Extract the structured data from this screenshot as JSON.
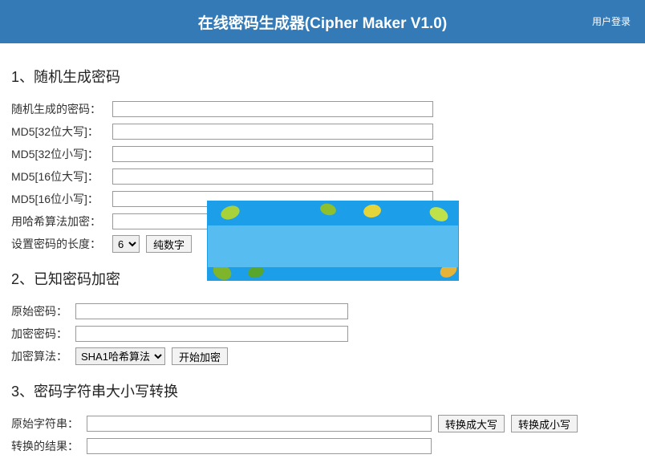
{
  "header": {
    "title": "在线密码生成器(Cipher Maker V1.0)",
    "login": "用户登录"
  },
  "section1": {
    "title": "1、随机生成密码",
    "rows": {
      "generated": "随机生成的密码：",
      "md5_32_upper": "MD5[32位大写]：",
      "md5_32_lower": "MD5[32位小写]：",
      "md5_16_upper": "MD5[16位大写]：",
      "md5_16_lower": "MD5[16位小写]：",
      "hash_encrypt": "用哈希算法加密：",
      "set_length": "设置密码的长度："
    },
    "length_value": "6",
    "type_button": "纯数字"
  },
  "section2": {
    "title": "2、已知密码加密",
    "rows": {
      "original": "原始密码：",
      "encrypted": "加密密码：",
      "algorithm": "加密算法："
    },
    "algorithm_value": "SHA1哈希算法",
    "encrypt_button": "开始加密"
  },
  "section3": {
    "title": "3、密码字符串大小写转换",
    "rows": {
      "original_str": "原始字符串：",
      "result": "转换的结果："
    },
    "to_upper": "转换成大写",
    "to_lower": "转换成小写"
  }
}
